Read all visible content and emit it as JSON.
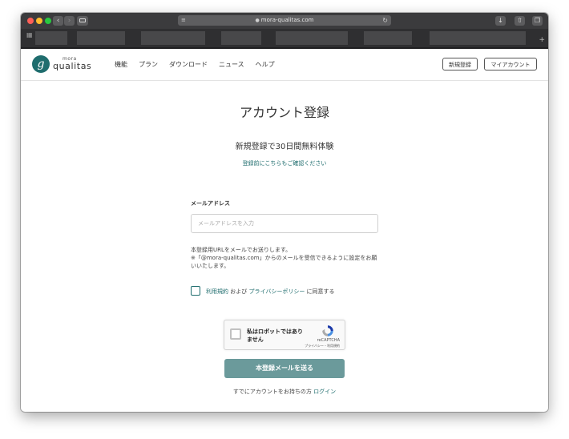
{
  "browser": {
    "url": "mora-qualitas.com",
    "icons": {
      "back": "chevron-left-icon",
      "forward": "chevron-right-icon",
      "sidebar": "sidebar-icon",
      "lock": "lock-icon",
      "reload": "reload-icon",
      "download": "download-icon",
      "share": "share-icon",
      "tabs": "tabs-icon"
    },
    "colors": {
      "close": "#fe5f57",
      "minimize": "#febc2e",
      "maximize": "#28c840"
    }
  },
  "header": {
    "logo_small": "mora",
    "logo_main": "qualitas",
    "nav": [
      "機能",
      "プラン",
      "ダウンロード",
      "ニュース",
      "ヘルプ"
    ],
    "register_button": "新規登録",
    "account_button": "マイアカウント"
  },
  "main": {
    "title": "アカウント登録",
    "subtitle": "新規登録で30日間無料体験",
    "confirm_link": "登録前にこちらもご確認ください",
    "email_label": "メールアドレス",
    "email_placeholder": "メールアドレスを入力",
    "email_value": "",
    "notice_line1": "本登録用URLをメールでお送りします。",
    "notice_line2": "※「@mora-qualitas.com」からのメールを受信できるように設定をお願",
    "notice_line3": "いいたします。",
    "terms_link": "利用規約",
    "and_text": " および ",
    "privacy_link": "プライバシーポリシー",
    "agree_suffix": " に同意する",
    "agree_checked": false,
    "recaptcha_label": "私はロボットではありません",
    "recaptcha_brand": "reCAPTCHA",
    "recaptcha_terms": "プライバシー・利用規約",
    "submit_button": "本登録メールを送る",
    "login_prefix": "すでにアカウントをお持ちの方 ",
    "login_link": "ログイン"
  },
  "colors": {
    "accent": "#1f6d6e",
    "button": "#6b9a9b"
  }
}
